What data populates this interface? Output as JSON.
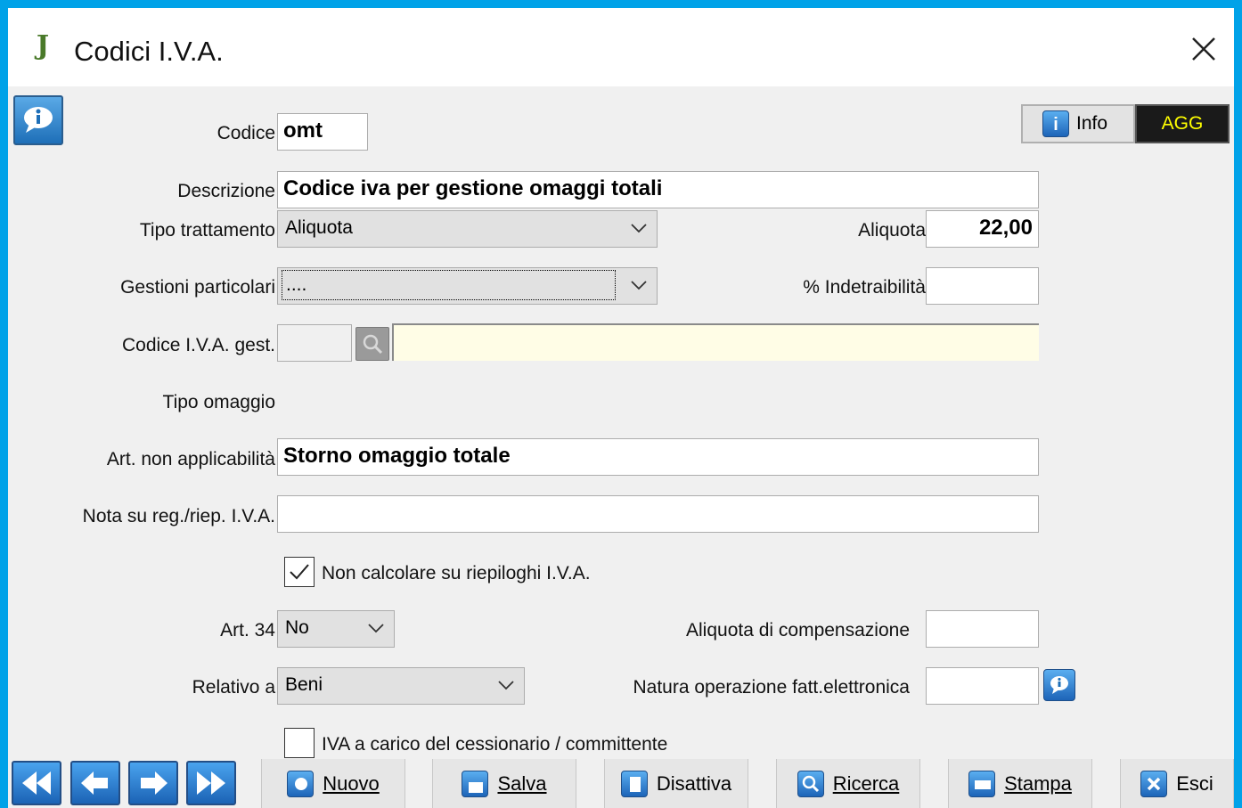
{
  "window": {
    "title": "Codici I.V.A."
  },
  "header": {
    "info_label": "Info",
    "agg_label": "AGG"
  },
  "form": {
    "codice": {
      "label": "Codice",
      "value": "omt"
    },
    "descrizione": {
      "label": "Descrizione",
      "value": "Codice iva per gestione omaggi totali"
    },
    "tipo_trattamento": {
      "label": "Tipo trattamento",
      "value": "Aliquota"
    },
    "aliquota": {
      "label": "Aliquota",
      "value": "22,00"
    },
    "gestioni_particolari": {
      "label": "Gestioni particolari",
      "value": "...."
    },
    "indetraibilita": {
      "label": "% Indetraibilità",
      "value": ""
    },
    "codice_iva_gest": {
      "label": "Codice I.V.A. gest.",
      "value": "",
      "description": ""
    },
    "tipo_omaggio": {
      "label": "Tipo omaggio"
    },
    "art_non_applicabilita": {
      "label": "Art. non applicabilità",
      "value": "Storno omaggio totale"
    },
    "nota": {
      "label": "Nota su reg./riep. I.V.A.",
      "value": ""
    },
    "non_calcolare": {
      "label": "Non calcolare su riepiloghi I.V.A.",
      "checked": true
    },
    "art34": {
      "label": "Art. 34",
      "value": "No"
    },
    "aliquota_compensazione": {
      "label": "Aliquota di compensazione",
      "value": ""
    },
    "relativo_a": {
      "label": "Relativo a",
      "value": "Beni"
    },
    "natura_operazione": {
      "label": "Natura operazione fatt.elettronica",
      "value": ""
    },
    "iva_carico": {
      "label": "IVA a carico del cessionario / committente",
      "checked": false
    }
  },
  "toolbar": {
    "nuovo": "Nuovo",
    "salva": "Salva",
    "disattiva": "Disattiva",
    "ricerca": "Ricerca",
    "stampa": "Stampa",
    "esci": "Esci"
  },
  "colors": {
    "accent": "#00a2e8",
    "yellow_field": "#fffde6",
    "agg_text": "#ffff00"
  }
}
